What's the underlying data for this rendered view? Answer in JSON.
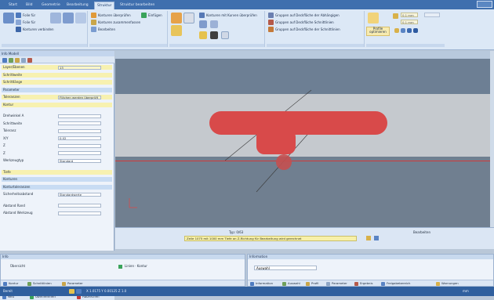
{
  "tabs": [
    "Start",
    "Bild",
    "Geometrie",
    "Bearbeitung",
    "Struktur",
    "Struktur bearbeiten"
  ],
  "active_tab_index": 4,
  "ribbon": {
    "group1": {
      "items": [
        "Folie für",
        "Folie für",
        "Konturen verbinden"
      ]
    },
    "group2": {
      "items": [
        "Konturen überprüfen",
        "Konturen zusammenfassen",
        "Bearbeiten"
      ],
      "extra": "Einfügen"
    },
    "group3": {
      "items": [
        "Konturen mit Kurven überprüfen",
        "",
        ""
      ]
    },
    "group4": {
      "items": [
        "Gruppen auf Deckfläche der Abhängigen",
        "Gruppen auf Deckfläche Schnittlinien",
        "Gruppen auf Deckfläche der Schnittlinien"
      ]
    },
    "group5": {
      "label": "Profile optimieren",
      "fields": [
        "0.1 mm",
        "0.1 mm",
        ""
      ]
    }
  },
  "left_panel": {
    "header": "Info Modell",
    "rows": [
      {
        "label": "Layer/Ebenen",
        "value": "13",
        "style": "yellow"
      },
      {
        "label": "Schrittweite",
        "value": "",
        "style": "yellow"
      },
      {
        "label": "Schrittlänge",
        "value": "",
        "style": "yellow"
      },
      {
        "label": "Parameter",
        "value": "",
        "style": "blue"
      },
      {
        "label": "Toleranzen",
        "value": "Flächen werden überprüft",
        "style": "yellow"
      },
      {
        "label": "Kontur",
        "value": "",
        "style": "yellow"
      },
      {
        "label": "",
        "value": "",
        "style": ""
      },
      {
        "label": "Drehwinkel A",
        "value": "",
        "style": ""
      },
      {
        "label": "Schrittweite",
        "value": "",
        "style": ""
      },
      {
        "label": "Toleranz",
        "value": "",
        "style": ""
      },
      {
        "label": "X/Y",
        "value": "0.02",
        "style": ""
      },
      {
        "label": "Z",
        "value": "",
        "style": ""
      },
      {
        "label": "Z",
        "value": "",
        "style": ""
      },
      {
        "label": "Werkzeugtyp",
        "value": "Standard",
        "style": ""
      },
      {
        "label": "",
        "value": "",
        "style": ""
      },
      {
        "label": "Tiefe",
        "value": "",
        "style": "yellow"
      },
      {
        "label": "Konturen",
        "value": "",
        "style": "blue"
      },
      {
        "label": "Konturtoleranzen",
        "value": "",
        "style": "blue"
      },
      {
        "label": "Sicherheitsabstand",
        "value": "Standardwerte",
        "style": ""
      },
      {
        "label": "",
        "value": "",
        "style": ""
      },
      {
        "label": "Abstand Rand",
        "value": "",
        "style": ""
      },
      {
        "label": "Abstand Werkzeug",
        "value": "",
        "style": ""
      }
    ],
    "bottom_buttons": [
      "Neu",
      "Übernehmen",
      "Abbrechen"
    ]
  },
  "status_area": {
    "line1": "Typ: 0/63",
    "yellow_text": "Zeile 1075 mit 1000 mm Tiefe an Z-Richtung für Bearbeitung wird gerechnet",
    "right_label": "Bearbeiten"
  },
  "bottom_left": {
    "title": "Info",
    "field_label": "Übersicht",
    "combo_label": "Linien · Kontur",
    "tabs": [
      "Kontur",
      "Schnittlinien",
      "Parameter"
    ]
  },
  "bottom_right": {
    "title": "Information",
    "field_label": "Auswahl",
    "tabs": [
      "Information",
      "Auswahl",
      "Profil",
      "Parameter",
      "Ergebnis",
      "Freigabebereich",
      "Warnungen"
    ]
  },
  "statusbar": {
    "left": "Bereit",
    "coords": "X 1.0175  Y 0.00125  Z 1.0",
    "right": "mm"
  },
  "colors": {
    "accent": "#3f6fae",
    "shape": "#d84a4a",
    "highlight": "#f7f1b0"
  }
}
